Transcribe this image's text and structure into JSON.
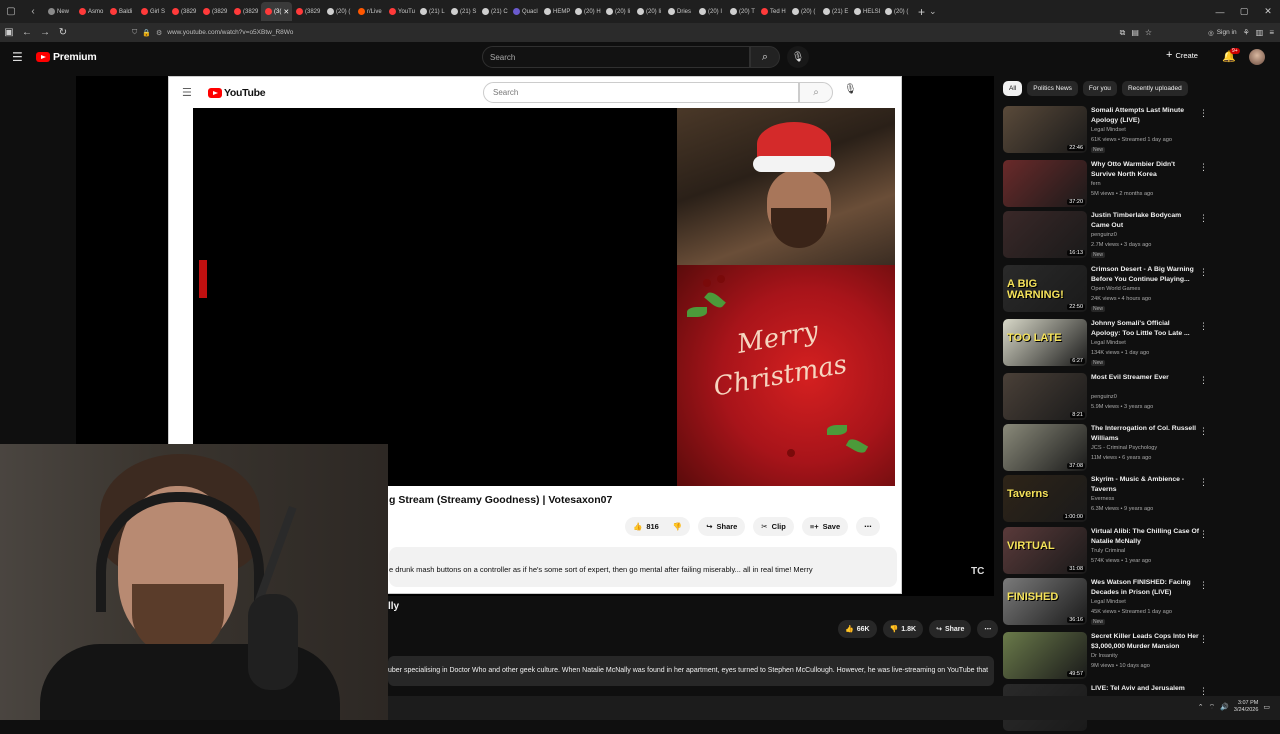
{
  "browser": {
    "tabs": [
      {
        "label": "New",
        "color": "#8a8a8a"
      },
      {
        "label": "Asmo",
        "color": "#ff3a3a"
      },
      {
        "label": "Baldi",
        "color": "#ff3a3a"
      },
      {
        "label": "Girl S",
        "color": "#ff3a3a"
      },
      {
        "label": "(3829",
        "color": "#ff3a3a"
      },
      {
        "label": "(3829",
        "color": "#ff3a3a"
      },
      {
        "label": "(3829",
        "color": "#ff3a3a"
      },
      {
        "label": "(3(",
        "color": "#ff3a3a",
        "active": true
      },
      {
        "label": "(3829",
        "color": "#ff3a3a"
      },
      {
        "label": "(20) (",
        "color": "#cfcfcf"
      },
      {
        "label": "r/Live",
        "color": "#ff5700"
      },
      {
        "label": "YouTu",
        "color": "#ff3a3a"
      },
      {
        "label": "(21) L",
        "color": "#cfcfcf"
      },
      {
        "label": "(21) S",
        "color": "#cfcfcf"
      },
      {
        "label": "(21) C",
        "color": "#cfcfcf"
      },
      {
        "label": "Quacl",
        "color": "#6a5acd"
      },
      {
        "label": "HEMP",
        "color": "#cfcfcf"
      },
      {
        "label": "(20) H",
        "color": "#cfcfcf"
      },
      {
        "label": "(20) Ii",
        "color": "#cfcfcf"
      },
      {
        "label": "(20) Ii",
        "color": "#cfcfcf"
      },
      {
        "label": "Dries",
        "color": "#cfcfcf"
      },
      {
        "label": "(20) I",
        "color": "#cfcfcf"
      },
      {
        "label": "(20) T",
        "color": "#cfcfcf"
      },
      {
        "label": "Ted H",
        "color": "#ff3a3a"
      },
      {
        "label": "(20) (",
        "color": "#cfcfcf"
      },
      {
        "label": "(21) E",
        "color": "#cfcfcf"
      },
      {
        "label": "HELSI",
        "color": "#cfcfcf"
      },
      {
        "label": "(20) (",
        "color": "#cfcfcf"
      }
    ],
    "url": "www.youtube.com/watch?v=o5XBtw_R8Wo",
    "sign_in": "Sign in",
    "icons": {
      "back": "←",
      "forward": "→",
      "reload": "↻",
      "shield": "⛉",
      "lock": "🔒",
      "menu": "≡"
    }
  },
  "yt": {
    "brand": "Premium",
    "search_placeholder": "Search",
    "create_label": "Create",
    "bell_badge": "9+"
  },
  "embedded": {
    "brand": "YouTube",
    "search_placeholder": "Search",
    "overlay_text_1": "Merry",
    "overlay_text_2": "Christmas",
    "title": "g Stream (Streamy Goodness) | Votesaxon07",
    "like_count": "816",
    "share_label": "Share",
    "clip_label": "Clip",
    "save_label": "Save",
    "description": "e drunk mash buttons on a controller as if he's some sort of expert, then go mental after failing miserably... all in real time!  Merry"
  },
  "main_video": {
    "title": "lly",
    "like_count": "66K",
    "dislike_count": "1.8K",
    "share_label": "Share",
    "description": "uber specialising in Doctor Who and other geek culture. When Natalie McNally was found in her apartment, eyes turned to Stephen McCullough. However, he was live-streaming on YouTube that",
    "watermark": "TC"
  },
  "sidebar": {
    "chips": [
      "All",
      "Politics News",
      "For you",
      "Recently uploaded"
    ],
    "recommendations": [
      {
        "title": "Somali Attempts Last Minute Apology (LIVE)",
        "channel": "Legal Mindset",
        "meta": "61K views • Streamed 1 day ago",
        "badge": "New",
        "duration": "22:46",
        "thumb_color": "#5a4a3a",
        "overlay": ""
      },
      {
        "title": "Why Otto Warmbier Didn't Survive North Korea",
        "channel": "fern",
        "meta": "5M views • 2 months ago",
        "badge": "",
        "duration": "37:20",
        "thumb_color": "#6a2a2a",
        "overlay": ""
      },
      {
        "title": "Justin Timberlake Bodycam Came Out",
        "channel": "penguinz0",
        "meta": "2.7M views • 3 days ago",
        "badge": "New",
        "duration": "16:13",
        "thumb_color": "#3a2828",
        "overlay": ""
      },
      {
        "title": "Crimson Desert - A Big Warning Before You Continue Playing...",
        "channel": "Open World Games",
        "meta": "24K views • 4 hours ago",
        "badge": "New",
        "duration": "22:50",
        "thumb_color": "#2a2a2a",
        "overlay": "A BIG WARNING!"
      },
      {
        "title": "Johnny Somali's Official Apology: Too Little Too Late ...",
        "channel": "Legal Mindset",
        "meta": "134K views • 1 day ago",
        "badge": "New",
        "duration": "6:27",
        "thumb_color": "#d8d8c8",
        "overlay": "TOO LATE"
      },
      {
        "title": "Most Evil Streamer Ever",
        "channel": "penguinz0",
        "meta": "5.9M views • 3 years ago",
        "badge": "",
        "duration": "8:21",
        "thumb_color": "#4a4038",
        "overlay": ""
      },
      {
        "title": "The Interrogation of Col. Russell Williams",
        "channel": "JCS - Criminal Psychology",
        "meta": "11M views • 6 years ago",
        "badge": "",
        "duration": "37:08",
        "thumb_color": "#8a8a7a",
        "overlay": ""
      },
      {
        "title": "Skyrim - Music & Ambience - Taverns",
        "channel": "Everness",
        "meta": "6.3M views • 9 years ago",
        "badge": "",
        "duration": "1:00:00",
        "thumb_color": "#2e2418",
        "overlay": "Taverns"
      },
      {
        "title": "Virtual Alibi: The Chilling Case Of Natalie McNally",
        "channel": "Truly Criminal",
        "meta": "574K views • 1 year ago",
        "badge": "",
        "duration": "31:08",
        "thumb_color": "#5a3a3a",
        "overlay": "VIRTUAL"
      },
      {
        "title": "Wes Watson FINISHED: Facing Decades in Prison (LIVE)",
        "channel": "Legal Mindset",
        "meta": "45K views • Streamed 1 day ago",
        "badge": "New",
        "duration": "36:16",
        "thumb_color": "#7a7a7a",
        "overlay": "FINISHED"
      },
      {
        "title": "Secret Killer Leads Cops Into Her $3,000,000 Murder Mansion",
        "channel": "Dr Insanity",
        "meta": "9M views • 10 days ago",
        "badge": "",
        "duration": "49:57",
        "thumb_color": "#6a7a4a",
        "overlay": ""
      },
      {
        "title": "LIVE: Tel Aviv and Jerusalem",
        "channel": "",
        "meta": "",
        "badge": "",
        "duration": "",
        "thumb_color": "#2a2a2a",
        "overlay": ""
      }
    ]
  },
  "taskbar": {
    "time": "3:07 PM",
    "date": "3/24/2026"
  }
}
